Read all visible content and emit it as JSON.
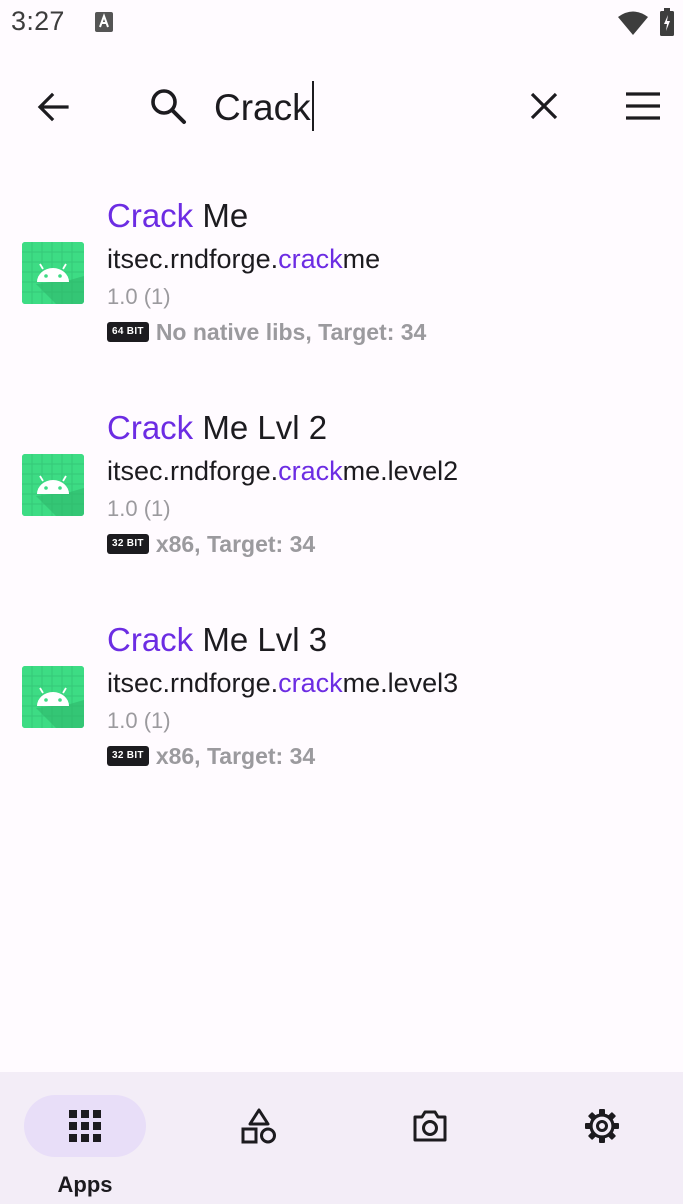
{
  "status_bar": {
    "time": "3:27"
  },
  "search": {
    "query": "Crack"
  },
  "apps": [
    {
      "name_highlight": "Crack",
      "name_rest": " Me",
      "pkg_prefix": "itsec.rndforge.",
      "pkg_highlight": "crack",
      "pkg_suffix": "me",
      "version": "1.0 (1)",
      "bits": "64 BIT",
      "meta": "No native libs, Target: 34"
    },
    {
      "name_highlight": "Crack",
      "name_rest": " Me Lvl 2",
      "pkg_prefix": "itsec.rndforge.",
      "pkg_highlight": "crack",
      "pkg_suffix": "me.level2",
      "version": "1.0 (1)",
      "bits": "32 BIT",
      "meta": "x86, Target: 34"
    },
    {
      "name_highlight": "Crack",
      "name_rest": " Me Lvl 3",
      "pkg_prefix": "itsec.rndforge.",
      "pkg_highlight": "crack",
      "pkg_suffix": "me.level3",
      "version": "1.0 (1)",
      "bits": "32 BIT",
      "meta": "x86, Target: 34"
    }
  ],
  "bottom_nav": {
    "apps_label": "Apps"
  },
  "colors": {
    "accent": "#6c2ce3",
    "android_green": "#3ddc84",
    "nav_background": "#f3edf7",
    "nav_active_pill": "#e8def8"
  }
}
